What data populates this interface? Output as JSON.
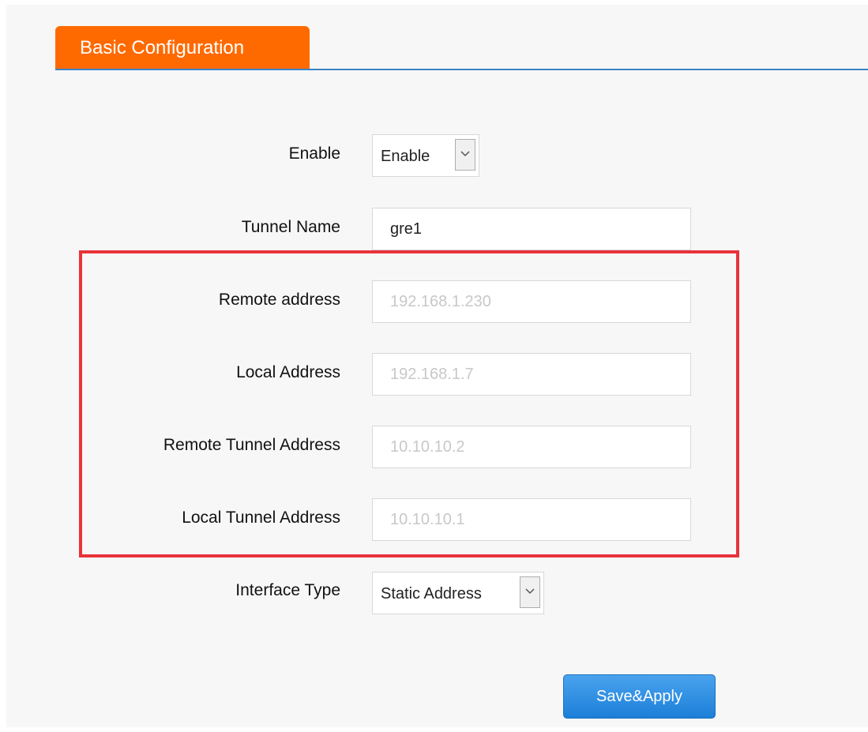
{
  "tab": {
    "label": "Basic Configuration"
  },
  "form": {
    "enable": {
      "label": "Enable",
      "value": "Enable"
    },
    "tunnel_name": {
      "label": "Tunnel Name",
      "value": "gre1"
    },
    "remote_address": {
      "label": "Remote address",
      "placeholder": "192.168.1.230"
    },
    "local_address": {
      "label": "Local Address",
      "placeholder": "192.168.1.7"
    },
    "remote_tunnel_address": {
      "label": "Remote Tunnel Address",
      "placeholder": "10.10.10.2"
    },
    "local_tunnel_address": {
      "label": "Local Tunnel Address",
      "placeholder": "10.10.10.1"
    },
    "interface_type": {
      "label": "Interface Type",
      "value": "Static Address"
    }
  },
  "actions": {
    "save_apply_label": "Save&Apply"
  },
  "colors": {
    "tab_accent": "#ff6a00",
    "tab_underline": "#3c82c8",
    "highlight_box": "#e8333a",
    "button_blue": "#1c7fd8"
  }
}
